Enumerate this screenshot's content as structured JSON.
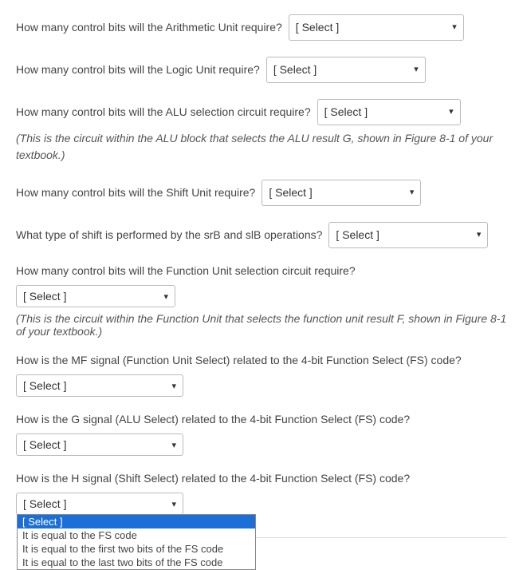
{
  "select_placeholder": "[ Select ]",
  "q1": {
    "text": "How many control bits will the Arithmetic Unit require?"
  },
  "q2": {
    "text": "How many control bits will the Logic Unit require?"
  },
  "q3": {
    "text": "How many control bits will the ALU selection circuit require?",
    "hint": "(This is the circuit within the ALU block that selects the ALU result G, shown in Figure 8-1 of your textbook.)"
  },
  "q4": {
    "text": "How many control bits will the Shift Unit require?"
  },
  "q5": {
    "text": "What type of shift is performed by the srB and slB operations?"
  },
  "q6": {
    "text": "How many control bits will the Function Unit selection circuit require?",
    "hint": "(This is the circuit within the Function Unit that selects the function unit result F, shown in Figure 8-1 of your textbook.)"
  },
  "q7": {
    "text": "How is the MF signal (Function Unit Select) related to the 4-bit Function Select (FS) code?"
  },
  "q8": {
    "text": "How is the G signal (ALU Select) related to the 4-bit Function Select (FS) code?"
  },
  "q9": {
    "text": "How is the H signal (Shift Select) related to the 4-bit Function Select (FS) code?",
    "options": [
      "[ Select ]",
      "It is equal to the FS code",
      "It is equal to the first two bits of the FS code",
      "It is equal to the last two bits of the FS code"
    ]
  }
}
